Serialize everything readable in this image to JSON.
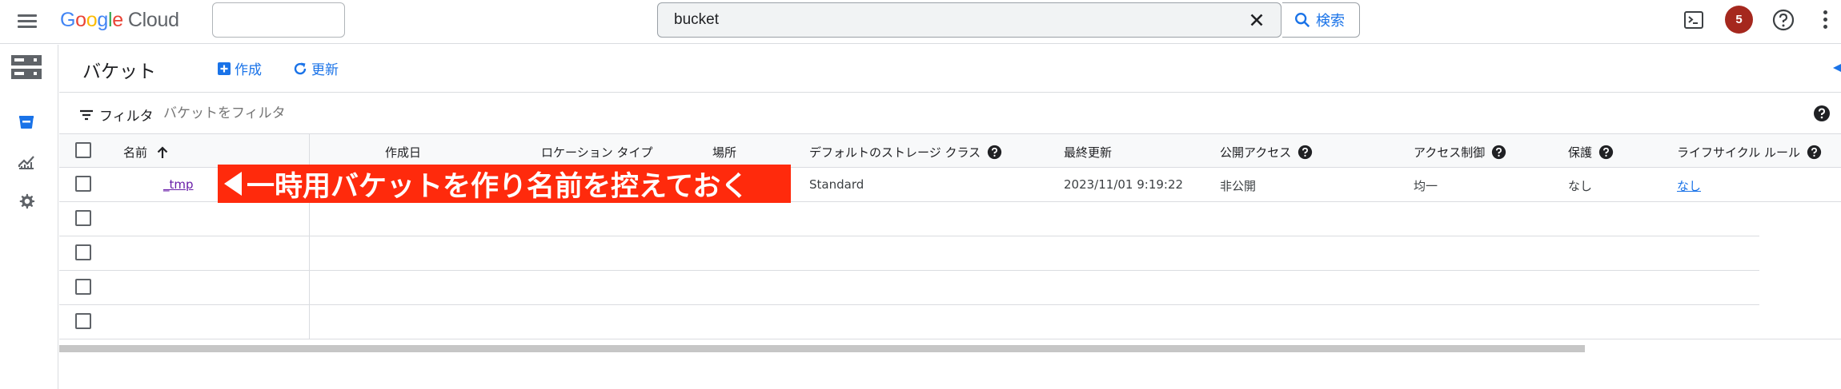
{
  "topbar": {
    "logo_google": [
      "G",
      "o",
      "o",
      "g",
      "l",
      "e"
    ],
    "logo_cloud": "Cloud",
    "search_value": "bucket",
    "search_button_label": "検索",
    "notification_count": "5"
  },
  "titlebar": {
    "title": "バケット",
    "create_label": "作成",
    "refresh_label": "更新"
  },
  "filter": {
    "label": "フィルタ",
    "placeholder": "バケットをフィルタ"
  },
  "table": {
    "columns": {
      "name": "名前",
      "created": "作成日",
      "location_type": "ロケーション タイプ",
      "location": "場所",
      "storage_class": "デフォルトのストレージ クラス",
      "updated": "最終更新",
      "public_access": "公開アクセス",
      "access_control": "アクセス制御",
      "protection": "保護",
      "lifecycle": "ライフサイクル ルール"
    },
    "rows": [
      {
        "name": "_tmp",
        "storage_class": "Standard",
        "updated": "2023/11/01 9:19:22",
        "public_access": "非公開",
        "access_control": "均一",
        "protection": "なし",
        "lifecycle": "なし"
      }
    ]
  },
  "annotation": {
    "text": "一時用バケットを作り名前を控えておく"
  },
  "colors": {
    "accent": "#1a73e8",
    "banner": "#ff2a0c",
    "avatar": "#a5281e"
  }
}
